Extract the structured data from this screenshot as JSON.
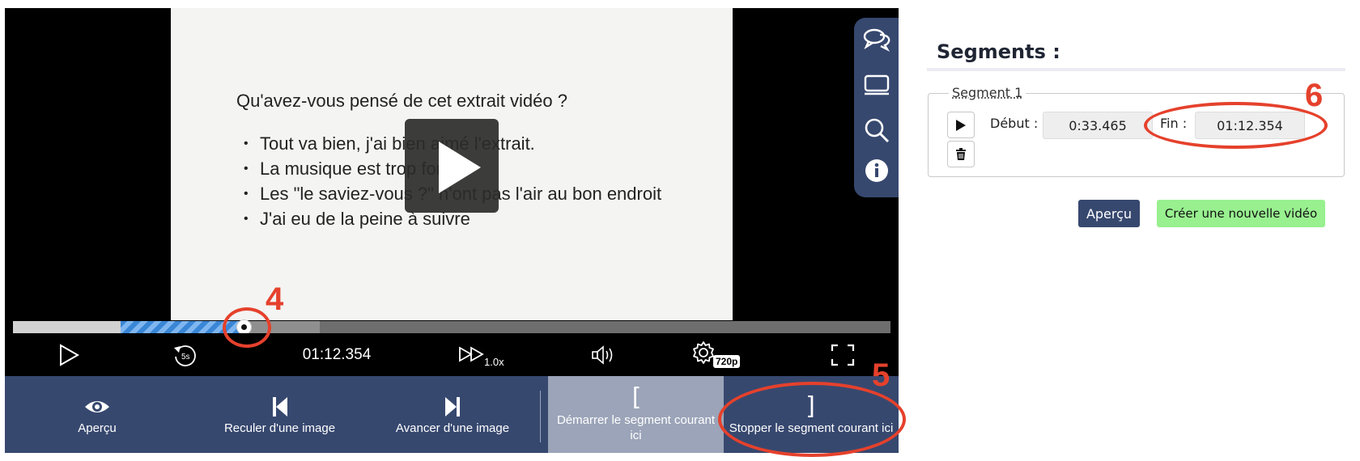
{
  "player": {
    "slide": {
      "question": "Qu'avez-vous pensé de cet extrait vidéo ?",
      "bullets": [
        "Tout va bien, j'ai bien aimé l'extrait.",
        "La musique est trop forte",
        "Les \"le saviez-vous ?\" n'ont pas l'air au bon endroit",
        "J'ai eu de la peine à suivre"
      ]
    },
    "side_tools": [
      "chat-bubbles-icon",
      "slides-icon",
      "search-icon",
      "info-icon"
    ],
    "progress": {
      "loaded_fraction": 0.35,
      "segment_start_fraction": 0.123,
      "segment_end_fraction": 0.264
    },
    "controls": {
      "replay_label": "5s",
      "time": "01:12.354",
      "speed": "1.0x",
      "quality": "720p"
    },
    "edit_bar": {
      "preview": "Aperçu",
      "prev_frame": "Reculer d'une image",
      "next_frame": "Avancer d'une image",
      "start_bracket": "[",
      "start_segment": "Démarrer le segment courant ici",
      "stop_bracket": "]",
      "stop_segment": "Stopper le segment courant ici"
    }
  },
  "segments_panel": {
    "title": "Segments :",
    "segment": {
      "legend": "Segment 1",
      "start_label": "Début :",
      "start_value": "0:33.465",
      "end_label": "Fin :",
      "end_value": "01:12.354"
    },
    "preview_button": "Aperçu",
    "create_button": "Créer une nouvelle vidéo"
  },
  "annotations": [
    "4",
    "5",
    "6"
  ],
  "colors": {
    "accent_navy": "#37486f",
    "create_green": "#98f08f",
    "annotation_red": "#e5412c"
  }
}
